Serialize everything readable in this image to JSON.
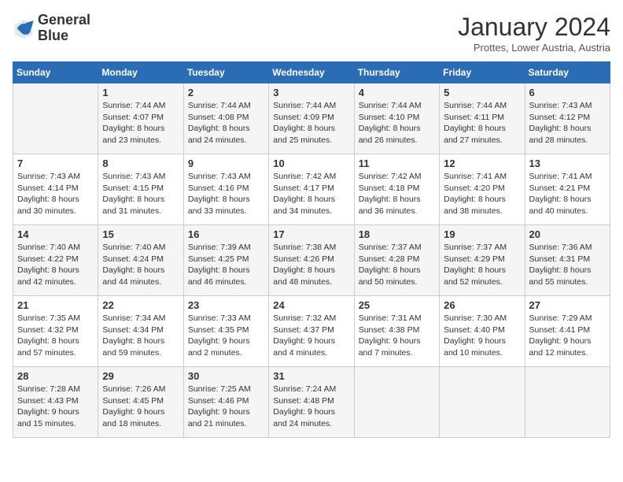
{
  "logo": {
    "line1": "General",
    "line2": "Blue"
  },
  "title": "January 2024",
  "subtitle": "Prottes, Lower Austria, Austria",
  "columns": [
    "Sunday",
    "Monday",
    "Tuesday",
    "Wednesday",
    "Thursday",
    "Friday",
    "Saturday"
  ],
  "weeks": [
    [
      {
        "day": "",
        "info": ""
      },
      {
        "day": "1",
        "info": "Sunrise: 7:44 AM\nSunset: 4:07 PM\nDaylight: 8 hours\nand 23 minutes."
      },
      {
        "day": "2",
        "info": "Sunrise: 7:44 AM\nSunset: 4:08 PM\nDaylight: 8 hours\nand 24 minutes."
      },
      {
        "day": "3",
        "info": "Sunrise: 7:44 AM\nSunset: 4:09 PM\nDaylight: 8 hours\nand 25 minutes."
      },
      {
        "day": "4",
        "info": "Sunrise: 7:44 AM\nSunset: 4:10 PM\nDaylight: 8 hours\nand 26 minutes."
      },
      {
        "day": "5",
        "info": "Sunrise: 7:44 AM\nSunset: 4:11 PM\nDaylight: 8 hours\nand 27 minutes."
      },
      {
        "day": "6",
        "info": "Sunrise: 7:43 AM\nSunset: 4:12 PM\nDaylight: 8 hours\nand 28 minutes."
      }
    ],
    [
      {
        "day": "7",
        "info": "Sunrise: 7:43 AM\nSunset: 4:14 PM\nDaylight: 8 hours\nand 30 minutes."
      },
      {
        "day": "8",
        "info": "Sunrise: 7:43 AM\nSunset: 4:15 PM\nDaylight: 8 hours\nand 31 minutes."
      },
      {
        "day": "9",
        "info": "Sunrise: 7:43 AM\nSunset: 4:16 PM\nDaylight: 8 hours\nand 33 minutes."
      },
      {
        "day": "10",
        "info": "Sunrise: 7:42 AM\nSunset: 4:17 PM\nDaylight: 8 hours\nand 34 minutes."
      },
      {
        "day": "11",
        "info": "Sunrise: 7:42 AM\nSunset: 4:18 PM\nDaylight: 8 hours\nand 36 minutes."
      },
      {
        "day": "12",
        "info": "Sunrise: 7:41 AM\nSunset: 4:20 PM\nDaylight: 8 hours\nand 38 minutes."
      },
      {
        "day": "13",
        "info": "Sunrise: 7:41 AM\nSunset: 4:21 PM\nDaylight: 8 hours\nand 40 minutes."
      }
    ],
    [
      {
        "day": "14",
        "info": "Sunrise: 7:40 AM\nSunset: 4:22 PM\nDaylight: 8 hours\nand 42 minutes."
      },
      {
        "day": "15",
        "info": "Sunrise: 7:40 AM\nSunset: 4:24 PM\nDaylight: 8 hours\nand 44 minutes."
      },
      {
        "day": "16",
        "info": "Sunrise: 7:39 AM\nSunset: 4:25 PM\nDaylight: 8 hours\nand 46 minutes."
      },
      {
        "day": "17",
        "info": "Sunrise: 7:38 AM\nSunset: 4:26 PM\nDaylight: 8 hours\nand 48 minutes."
      },
      {
        "day": "18",
        "info": "Sunrise: 7:37 AM\nSunset: 4:28 PM\nDaylight: 8 hours\nand 50 minutes."
      },
      {
        "day": "19",
        "info": "Sunrise: 7:37 AM\nSunset: 4:29 PM\nDaylight: 8 hours\nand 52 minutes."
      },
      {
        "day": "20",
        "info": "Sunrise: 7:36 AM\nSunset: 4:31 PM\nDaylight: 8 hours\nand 55 minutes."
      }
    ],
    [
      {
        "day": "21",
        "info": "Sunrise: 7:35 AM\nSunset: 4:32 PM\nDaylight: 8 hours\nand 57 minutes."
      },
      {
        "day": "22",
        "info": "Sunrise: 7:34 AM\nSunset: 4:34 PM\nDaylight: 8 hours\nand 59 minutes."
      },
      {
        "day": "23",
        "info": "Sunrise: 7:33 AM\nSunset: 4:35 PM\nDaylight: 9 hours\nand 2 minutes."
      },
      {
        "day": "24",
        "info": "Sunrise: 7:32 AM\nSunset: 4:37 PM\nDaylight: 9 hours\nand 4 minutes."
      },
      {
        "day": "25",
        "info": "Sunrise: 7:31 AM\nSunset: 4:38 PM\nDaylight: 9 hours\nand 7 minutes."
      },
      {
        "day": "26",
        "info": "Sunrise: 7:30 AM\nSunset: 4:40 PM\nDaylight: 9 hours\nand 10 minutes."
      },
      {
        "day": "27",
        "info": "Sunrise: 7:29 AM\nSunset: 4:41 PM\nDaylight: 9 hours\nand 12 minutes."
      }
    ],
    [
      {
        "day": "28",
        "info": "Sunrise: 7:28 AM\nSunset: 4:43 PM\nDaylight: 9 hours\nand 15 minutes."
      },
      {
        "day": "29",
        "info": "Sunrise: 7:26 AM\nSunset: 4:45 PM\nDaylight: 9 hours\nand 18 minutes."
      },
      {
        "day": "30",
        "info": "Sunrise: 7:25 AM\nSunset: 4:46 PM\nDaylight: 9 hours\nand 21 minutes."
      },
      {
        "day": "31",
        "info": "Sunrise: 7:24 AM\nSunset: 4:48 PM\nDaylight: 9 hours\nand 24 minutes."
      },
      {
        "day": "",
        "info": ""
      },
      {
        "day": "",
        "info": ""
      },
      {
        "day": "",
        "info": ""
      }
    ]
  ]
}
